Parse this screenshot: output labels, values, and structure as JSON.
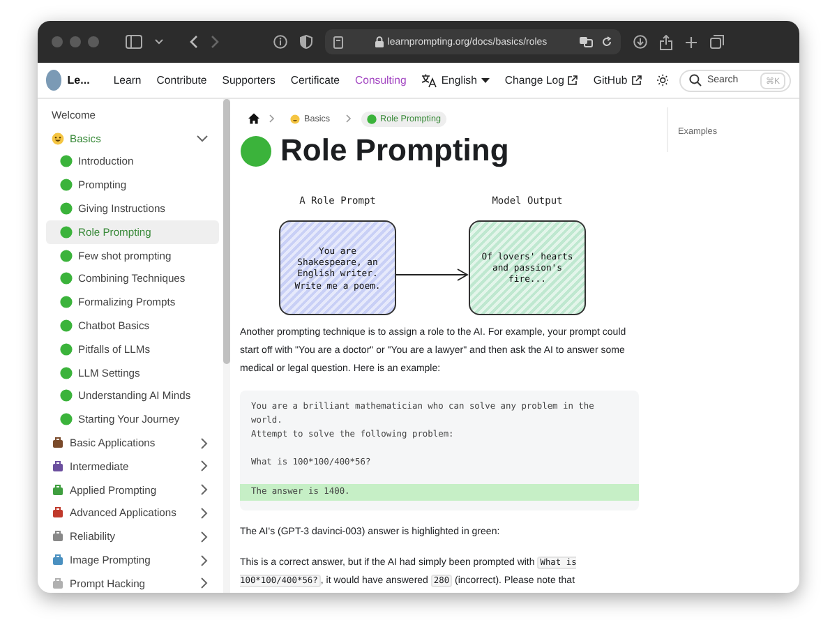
{
  "browser": {
    "url": "learnprompting.org/docs/basics/roles"
  },
  "nav": {
    "logo_text": "Le...",
    "links": [
      {
        "label": "Learn",
        "highlighted": false
      },
      {
        "label": "Contribute",
        "highlighted": false
      },
      {
        "label": "Supporters",
        "highlighted": false
      },
      {
        "label": "Certificate",
        "highlighted": false
      },
      {
        "label": "Consulting",
        "highlighted": true
      }
    ],
    "language": "English",
    "external_links": [
      "Change Log",
      "GitHub"
    ],
    "search": {
      "placeholder": "Search",
      "shortcut": "⌘K"
    }
  },
  "sidebar": {
    "items": [
      {
        "label": "Welcome",
        "selected": false
      },
      {
        "label": "Basics",
        "selected": false,
        "expanded": true,
        "children": [
          {
            "label": "Introduction",
            "selected": false
          },
          {
            "label": "Prompting",
            "selected": false
          },
          {
            "label": "Giving Instructions",
            "selected": false
          },
          {
            "label": "Role Prompting",
            "selected": true
          },
          {
            "label": "Few shot prompting",
            "selected": false
          },
          {
            "label": "Combining Techniques",
            "selected": false
          },
          {
            "label": "Formalizing Prompts",
            "selected": false
          },
          {
            "label": "Chatbot Basics",
            "selected": false
          },
          {
            "label": "Pitfalls of LLMs",
            "selected": false
          },
          {
            "label": "LLM Settings",
            "selected": false
          },
          {
            "label": "Understanding AI Minds",
            "selected": false
          },
          {
            "label": "Starting Your Journey",
            "selected": false
          }
        ]
      },
      {
        "label": "Basic Applications",
        "selected": false,
        "expanded": false
      },
      {
        "label": "Intermediate",
        "selected": false,
        "expanded": false
      },
      {
        "label": "Applied Prompting",
        "selected": false,
        "expanded": false
      },
      {
        "label": "Advanced Applications",
        "selected": false,
        "expanded": false
      },
      {
        "label": "Reliability",
        "selected": false,
        "expanded": false
      },
      {
        "label": "Image Prompting",
        "selected": false,
        "expanded": false
      },
      {
        "label": "Prompt Hacking",
        "selected": false,
        "expanded": false
      }
    ]
  },
  "breadcrumbs": [
    {
      "label": "Basics",
      "selected": false
    },
    {
      "label": "Role Prompting",
      "selected": true
    }
  ],
  "title": "Role Prompting",
  "figure": {
    "left_title": "A Role Prompt",
    "left_text": "You are Shakespeare, an English writer. Write me a poem.",
    "right_title": "Model Output",
    "right_text": "Of lovers' hearts and passion's fire..."
  },
  "intro": "Another prompting technique is to assign a role to the AI. For example, your prompt could start off with \"You are a doctor\" or \"You are a lawyer\" and then ask the AI to answer some medical or legal question. Here is an example:",
  "code_lines": [
    {
      "text": "You are a brilliant mathematician who can solve any problem in the world.",
      "highlighted": false
    },
    {
      "text": "Attempt to solve the following problem:",
      "highlighted": false
    },
    {
      "text": "What is 100*100/400*56?",
      "highlighted": false,
      "blank_before": true
    },
    {
      "text": "The answer is 1400.",
      "highlighted": true,
      "blank_before": true
    }
  ],
  "caption": "The AI's (GPT-3 davinci-003) answer is highlighted in green:",
  "explanation": [
    {
      "text": "This is a correct answer, but if the AI had simply been prompted with ",
      "code": false
    },
    {
      "text": "What is 100*100/400*56?",
      "code": true
    },
    {
      "text": ", it would have answered ",
      "code": false
    },
    {
      "text": "280",
      "code": true
    },
    {
      "text": " (incorrect). Please note that",
      "code": false
    }
  ],
  "toc": [
    "Examples"
  ]
}
